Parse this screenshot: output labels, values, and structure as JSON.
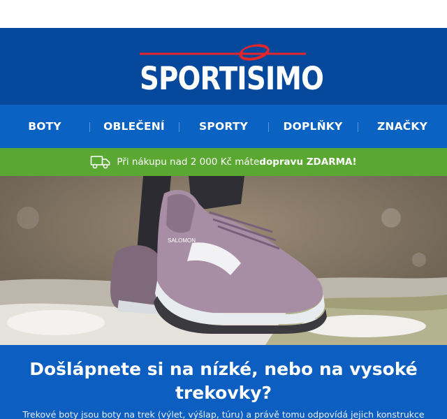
{
  "brand": {
    "name": "SPORTISIMO"
  },
  "nav": {
    "items": [
      {
        "label": "BOTY"
      },
      {
        "label": "OBLEČENÍ"
      },
      {
        "label": "SPORTY"
      },
      {
        "label": "DOPLŇKY"
      },
      {
        "label": "ZNAČKY"
      }
    ]
  },
  "promo": {
    "text": "Při nákupu nad 2 000 Kč máte ",
    "highlight": "dopravu ZDARMA!"
  },
  "hero": {
    "brand_on_shoe": "SALOMON"
  },
  "article": {
    "title_line1": "Došlápnete si na nízké, nebo na vysoké",
    "title_line2": "trekovky?",
    "intro": "Trekové boty jsou boty na trek (výlet, výšlap, túru) a právě tomu odpovídá jejich konstrukce"
  },
  "colors": {
    "header_blue": "#06499c",
    "nav_blue": "#0a62c2",
    "promo_green": "#5aa832",
    "logo_red": "#e3262b"
  }
}
